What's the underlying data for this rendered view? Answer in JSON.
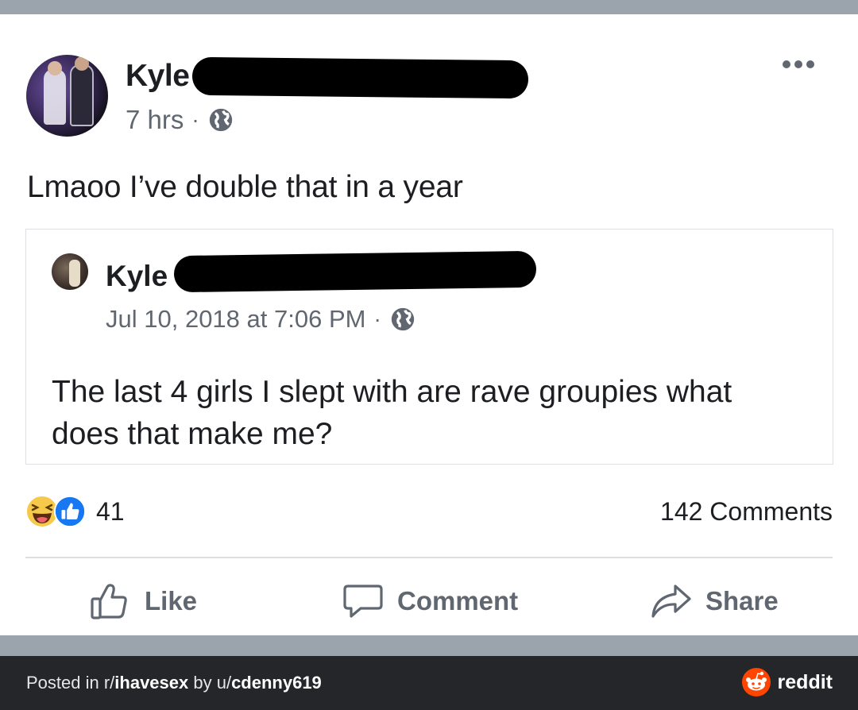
{
  "post": {
    "author": "Kyle",
    "time": "7 hrs",
    "dot": "·",
    "text": "Lmaoo I’ve double that in a year"
  },
  "shared_post": {
    "author": "Kyle",
    "time": "Jul 10, 2018 at 7:06 PM",
    "dot": "·",
    "text": "The last 4 girls I slept with are rave groupies what does that make me?"
  },
  "reactions": {
    "count": "41",
    "icons": [
      "haha-icon",
      "like-icon"
    ],
    "comments": "142 Comments"
  },
  "actions": {
    "like": "Like",
    "comment": "Comment",
    "share": "Share"
  },
  "footer": {
    "posted_in_prefix": "Posted in r/",
    "subreddit": "ihavesex",
    "by_prefix": " by u/",
    "user": "cdenny619",
    "brand": "reddit"
  },
  "colors": {
    "text": "#1c1e21",
    "secondary": "#606770",
    "like_blue": "#1877f2",
    "haha_yellow": "#f7c94b",
    "reddit_orange": "#ff4500",
    "footer_bg": "#242629"
  }
}
